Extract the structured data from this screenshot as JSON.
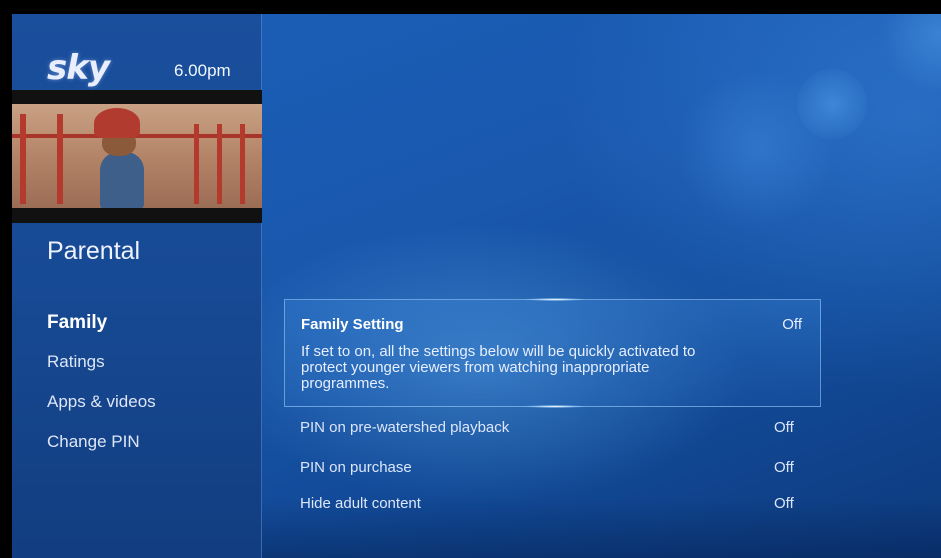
{
  "header": {
    "logo_text": "sky",
    "time": "6.00pm"
  },
  "preview": {
    "description_icon": "video-preview"
  },
  "sidebar": {
    "section_title": "Parental",
    "items": [
      {
        "label": "Family",
        "active": true
      },
      {
        "label": "Ratings",
        "active": false
      },
      {
        "label": "Apps & videos",
        "active": false
      },
      {
        "label": "Change PIN",
        "active": false
      }
    ]
  },
  "settings": {
    "selected": {
      "title": "Family Setting",
      "value": "Off",
      "description": "If set to on, all the settings below will be quickly activated to protect younger viewers from watching inappropriate programmes."
    },
    "rows": [
      {
        "label": "PIN on pre-watershed playback",
        "value": "Off"
      },
      {
        "label": "PIN on purchase",
        "value": "Off"
      },
      {
        "label": "Hide adult content",
        "value": "Off"
      }
    ]
  },
  "colors": {
    "background": "#1a58ae",
    "sidebar": "#174a94",
    "accent": "#a0d2ff"
  }
}
